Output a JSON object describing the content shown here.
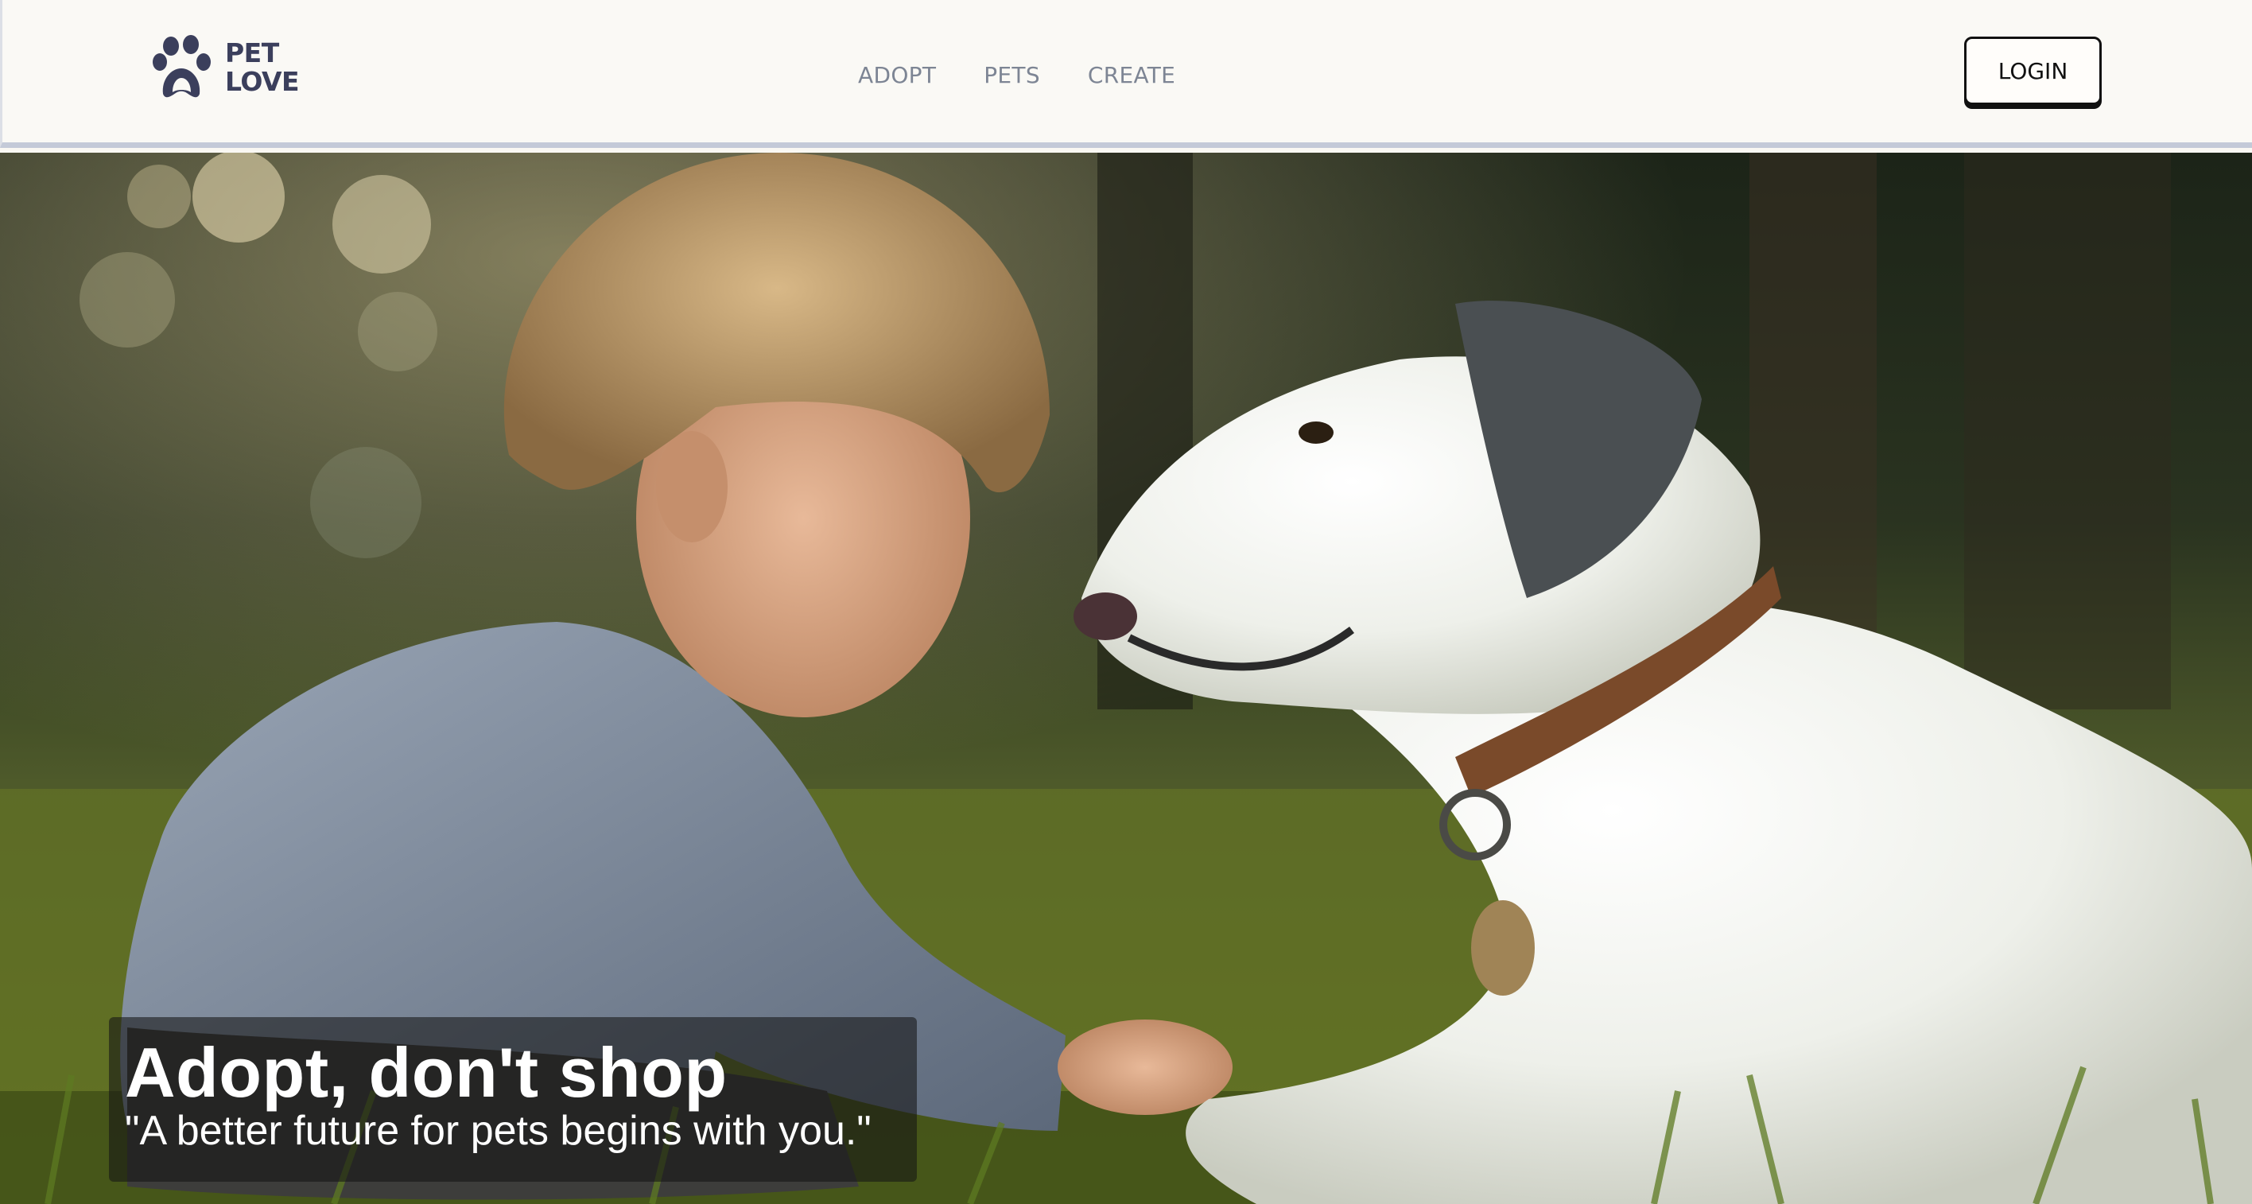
{
  "brand": {
    "logo_line1": "PET",
    "logo_line2": "LOVE",
    "logo_icon": "paw-icon",
    "color": "#3b3f5c"
  },
  "nav": {
    "items": [
      {
        "label": "ADOPT"
      },
      {
        "label": "PETS"
      },
      {
        "label": "CREATE"
      }
    ],
    "color": "#7d8594"
  },
  "header": {
    "login_label": "LOGIN"
  },
  "hero": {
    "image_alt": "Child sitting in grass with a white dog",
    "title": "Adopt, don't shop",
    "subtitle": "\"A better future for pets begins with you.\""
  }
}
